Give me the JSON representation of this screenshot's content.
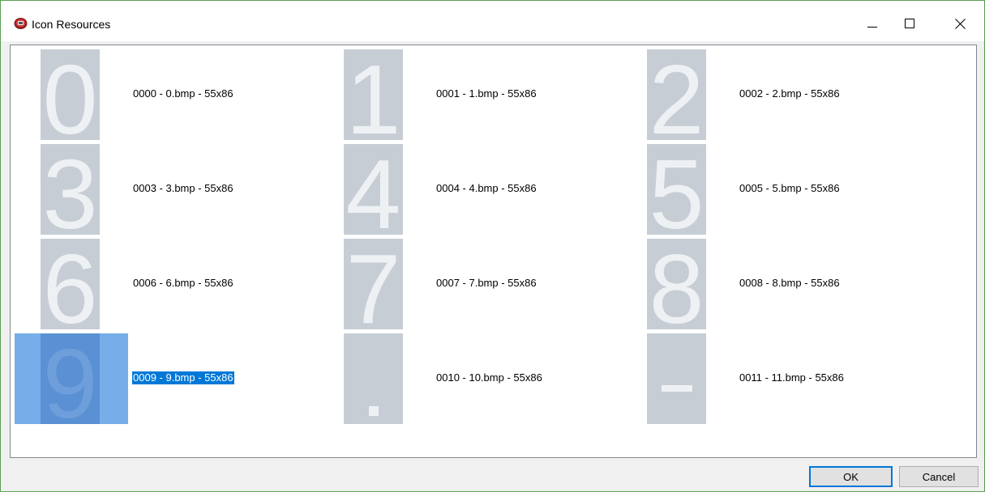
{
  "window": {
    "title": "Icon Resources",
    "icon": "app-icon",
    "accent": "#5aa052"
  },
  "controls": {
    "minimize": "minimize-icon",
    "maximize": "maximize-icon",
    "close": "close-icon"
  },
  "icons": {
    "items": [
      {
        "glyph": "0",
        "label": "0000 - 0.bmp - 55x86"
      },
      {
        "glyph": "1",
        "label": "0001 - 1.bmp - 55x86"
      },
      {
        "glyph": "2",
        "label": "0002 - 2.bmp - 55x86"
      },
      {
        "glyph": "3",
        "label": "0003 - 3.bmp - 55x86"
      },
      {
        "glyph": "4",
        "label": "0004 - 4.bmp - 55x86"
      },
      {
        "glyph": "5",
        "label": "0005 - 5.bmp - 55x86"
      },
      {
        "glyph": "6",
        "label": "0006 - 6.bmp - 55x86"
      },
      {
        "glyph": "7",
        "label": "0007 - 7.bmp - 55x86"
      },
      {
        "glyph": "8",
        "label": "0008 - 8.bmp - 55x86"
      },
      {
        "glyph": "9",
        "label": "0009 - 9.bmp - 55x86",
        "selected": true
      },
      {
        "glyph": ".",
        "label": "0010 - 10.bmp - 55x86"
      },
      {
        "glyph": "-",
        "label": "0011 - 11.bmp - 55x86"
      }
    ]
  },
  "buttons": {
    "ok": "OK",
    "cancel": "Cancel"
  },
  "colors": {
    "thumb_bg": "#c7cdd4",
    "glyph": "#eef1f4",
    "selection": "#0078d7",
    "selection_light": "#77ade8"
  }
}
